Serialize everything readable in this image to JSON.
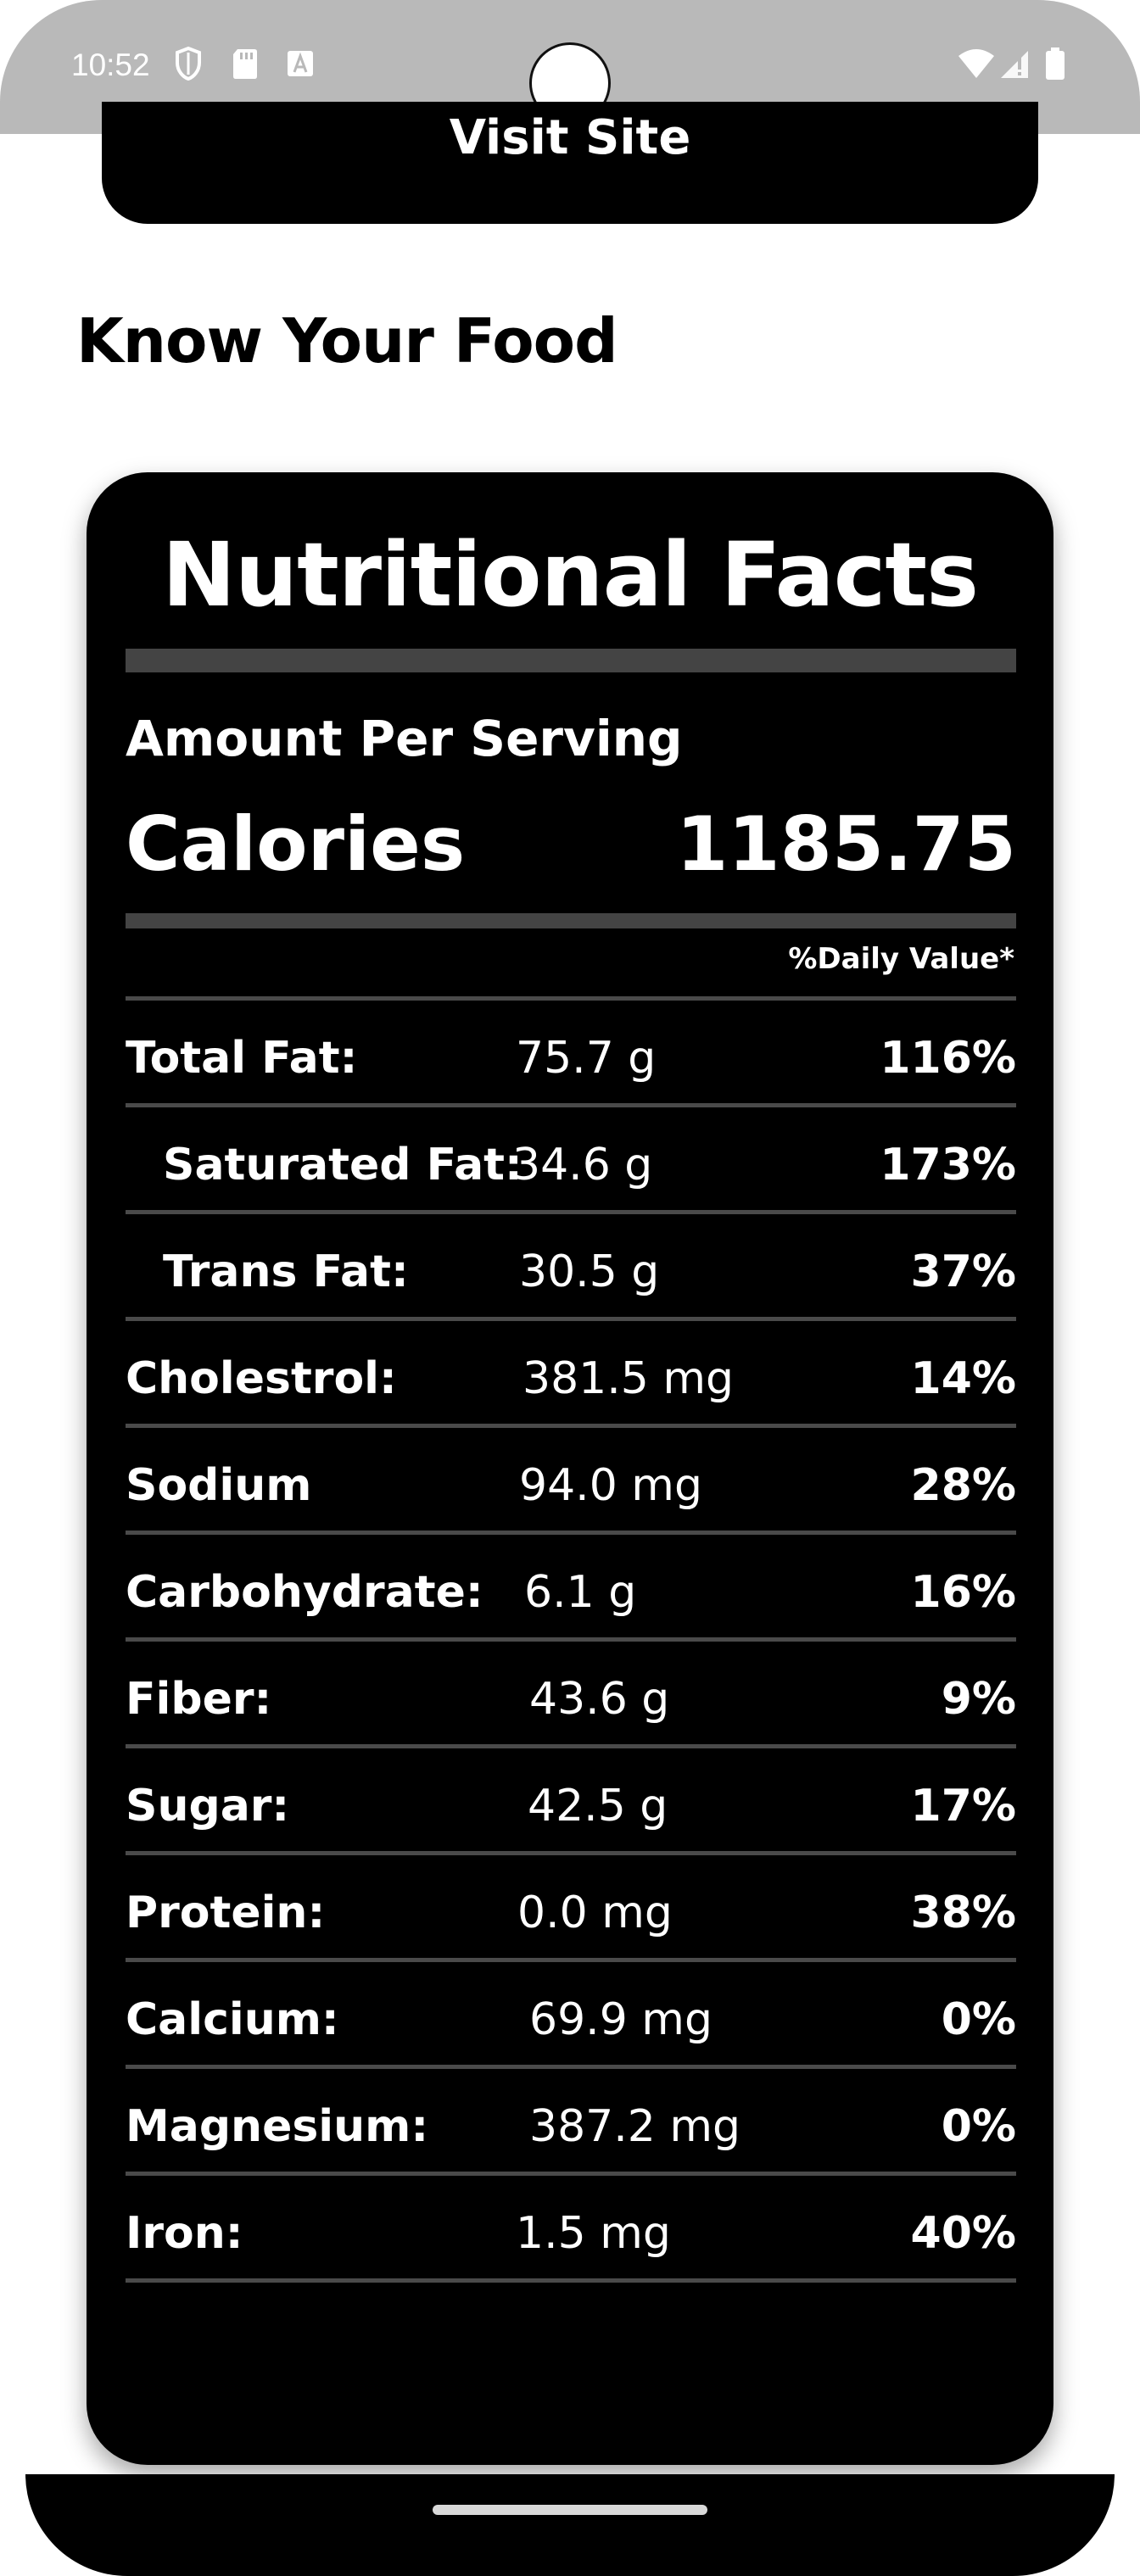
{
  "status_bar": {
    "time": "10:52"
  },
  "visit_button": {
    "label": "Visit Site"
  },
  "section_title": "Know Your Food",
  "nutrition": {
    "title": "Nutritional Facts",
    "amount_per_serving": "Amount Per Serving",
    "calories_label": "Calories",
    "calories_value": "1185.75",
    "daily_value_header": "%Daily Value*",
    "rows": [
      {
        "label": "Total Fat:",
        "amount": "75.7 g",
        "percent": "116%"
      },
      {
        "label": "Saturated Fat:",
        "amount": "34.6 g",
        "percent": "173%"
      },
      {
        "label": "Trans Fat:",
        "amount": "30.5 g",
        "percent": "37%"
      },
      {
        "label": "Cholestrol:",
        "amount": "381.5 mg",
        "percent": "14%"
      },
      {
        "label": "Sodium",
        "amount": "94.0 mg",
        "percent": "28%"
      },
      {
        "label": "Carbohydrate:",
        "amount": "6.1 g",
        "percent": "16%"
      },
      {
        "label": "Fiber:",
        "amount": "43.6 g",
        "percent": "9%"
      },
      {
        "label": "Sugar:",
        "amount": "42.5 g",
        "percent": "17%"
      },
      {
        "label": "Protein:",
        "amount": "0.0 mg",
        "percent": "38%"
      },
      {
        "label": "Calcium:",
        "amount": "69.9 mg",
        "percent": "0%"
      },
      {
        "label": "Magnesium:",
        "amount": "387.2 mg",
        "percent": "0%"
      },
      {
        "label": "Iron:",
        "amount": "1.5 mg",
        "percent": "40%"
      }
    ]
  },
  "icons": [
    "shield-icon",
    "sd-card-icon",
    "a-icon",
    "wifi-icon",
    "signal-icon",
    "battery-icon"
  ],
  "colors": {
    "card": "#000000",
    "status_bar": "#b9b9b9",
    "separator": "#4a4a4a"
  }
}
